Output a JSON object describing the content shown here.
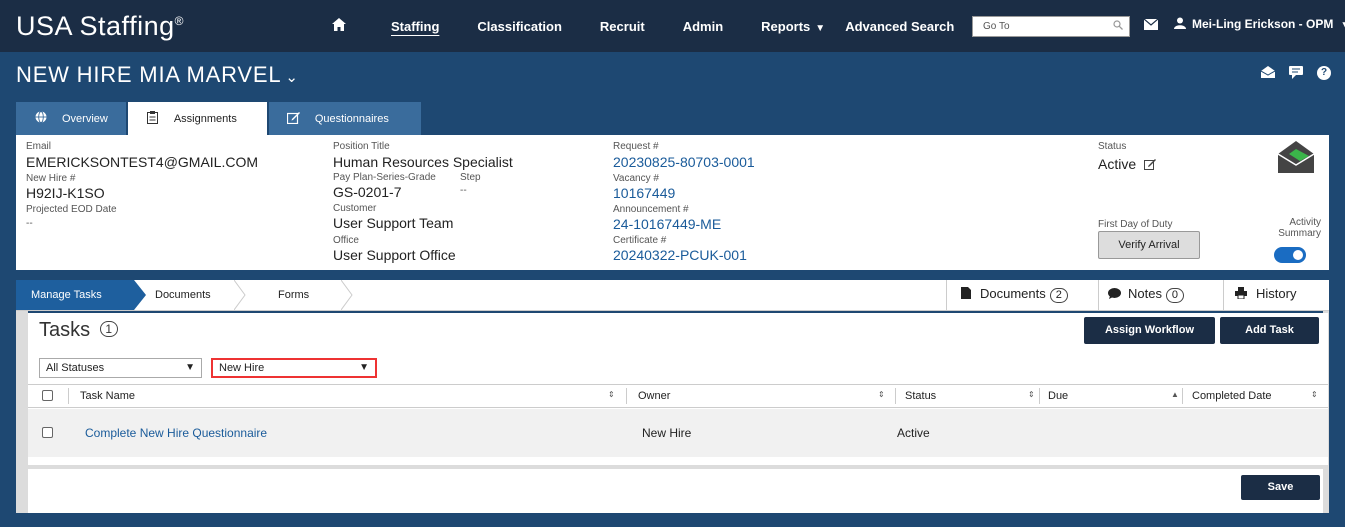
{
  "app": {
    "brand": "USA Staffing",
    "brand_mark": "®"
  },
  "nav": {
    "items": [
      "Staffing",
      "Classification",
      "Recruit",
      "Admin",
      "Reports",
      "Advanced Search"
    ],
    "goto_placeholder": "Go To",
    "user_name": "Mei-Ling Erickson - OPM"
  },
  "page": {
    "title": "NEW HIRE MIA MARVEL"
  },
  "tabs": [
    "Overview",
    "Assignments",
    "Questionnaires"
  ],
  "info": {
    "email_label": "Email",
    "email_value": "EMERICKSONTEST4@GMAIL.COM",
    "newhire_label": "New Hire #",
    "newhire_value": "H92IJ-K1SO",
    "eod_label": "Projected EOD Date",
    "eod_value": "--",
    "position_label": "Position Title",
    "position_value": "Human Resources Specialist",
    "ppg_label": "Pay Plan-Series-Grade",
    "ppg_value": "GS-0201-7",
    "step_label": "Step",
    "step_value": "--",
    "customer_label": "Customer",
    "customer_value": "User Support Team",
    "office_label": "Office",
    "office_value": "User Support Office",
    "request_label": "Request #",
    "request_value": "20230825-80703-0001",
    "vacancy_label": "Vacancy #",
    "vacancy_value": "10167449",
    "announcement_label": "Announcement #",
    "announcement_value": "24-10167449-ME",
    "certificate_label": "Certificate #",
    "certificate_value": "20240322-PCUK-001",
    "status_label": "Status",
    "status_value": "Active",
    "fdd_label": "First Day of Duty",
    "verify_label": "Verify Arrival",
    "activity_label_1": "Activity",
    "activity_label_2": "Summary",
    "activity_summary_on": true
  },
  "subnav": {
    "steps": [
      "Manage Tasks",
      "Documents",
      "Forms"
    ],
    "documents_label": "Documents",
    "documents_count": "2",
    "notes_label": "Notes",
    "notes_count": "0",
    "history_label": "History"
  },
  "tasks": {
    "title": "Tasks",
    "count": "1",
    "assign_workflow": "Assign Workflow",
    "add_task": "Add Task",
    "status_filter": "All Statuses",
    "type_filter": "New Hire",
    "columns": [
      "Task Name",
      "Owner",
      "Status",
      "Due",
      "Completed Date"
    ],
    "rows": [
      {
        "task_name": "Complete New Hire Questionnaire",
        "owner": "New Hire",
        "status": "Active",
        "due": "",
        "completed": ""
      }
    ]
  },
  "footer": {
    "save": "Save"
  }
}
